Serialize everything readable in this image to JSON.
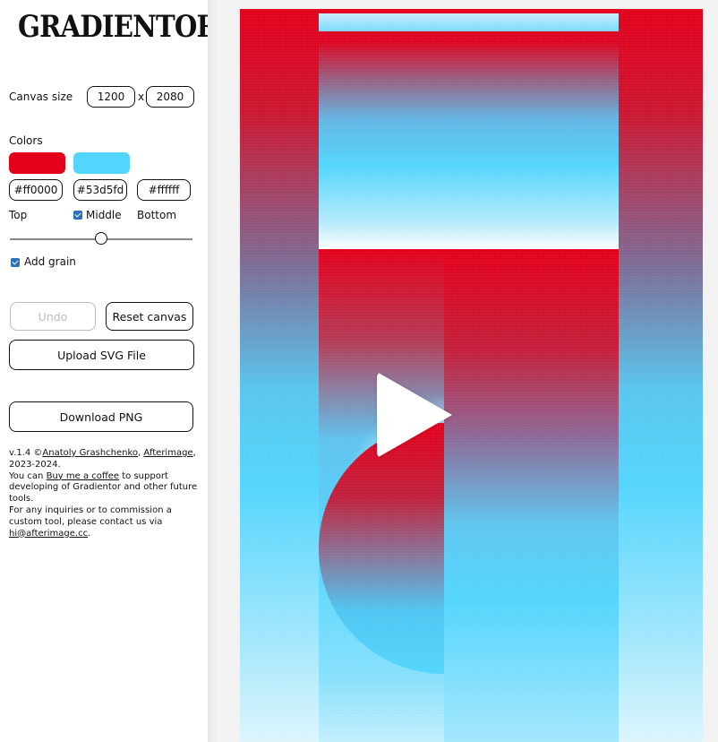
{
  "app": {
    "title": "GRADIENTOR"
  },
  "canvas_size": {
    "label": "Canvas size",
    "width": "1200",
    "separator": "x",
    "height": "2080"
  },
  "colors": {
    "label": "Colors",
    "top": {
      "hex": "#ff0000",
      "label": "Top",
      "swatch": "#e3001b"
    },
    "middle": {
      "hex": "#53d5fd",
      "label": "Middle",
      "swatch": "#53d5fd",
      "checked": true
    },
    "bottom": {
      "hex": "#ffffff",
      "label": "Bottom"
    }
  },
  "slider": {
    "value": 0.5
  },
  "grain": {
    "label": "Add grain",
    "checked": true
  },
  "buttons": {
    "undo": "Undo",
    "reset": "Reset canvas",
    "upload": "Upload SVG File",
    "download": "Download PNG"
  },
  "footer": {
    "version": "v.1.4 ©",
    "author": "Anatoly Grashchenko",
    "comma": ",",
    "studio": "Afterimage",
    "years": ", 2023-2024.",
    "support_pre": "You can",
    "coffee": "Buy me a coffee",
    "support_post": "to support developing of Gradientor and other future tools.",
    "contact": "For any inquiries or to commission a custom tool, please contact us via",
    "email": "hi@afterimage.cc",
    "period": "."
  },
  "video": {
    "icon": "play-icon"
  }
}
